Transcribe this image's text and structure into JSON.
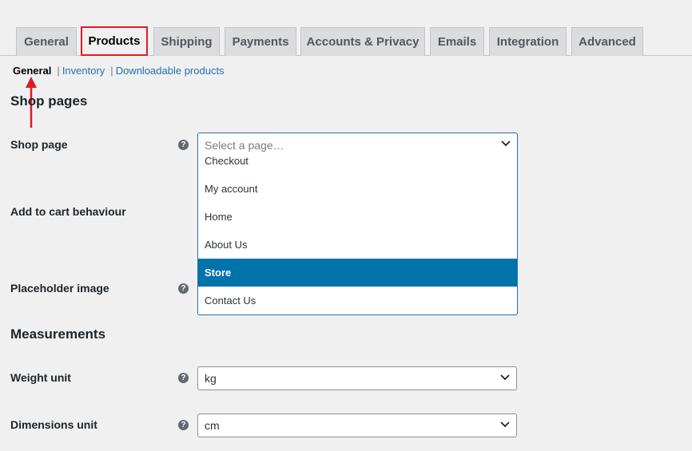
{
  "tabs": [
    {
      "label": "General"
    },
    {
      "label": "Products",
      "active": true
    },
    {
      "label": "Shipping"
    },
    {
      "label": "Payments"
    },
    {
      "label": "Accounts & Privacy"
    },
    {
      "label": "Emails"
    },
    {
      "label": "Integration"
    },
    {
      "label": "Advanced"
    }
  ],
  "subnav": {
    "current": "General",
    "links": [
      "Inventory",
      "Downloadable products"
    ]
  },
  "sections": {
    "shop_pages": "Shop pages",
    "measurements": "Measurements"
  },
  "fields": {
    "shop_page": {
      "label": "Shop page",
      "placeholder": "Select a page…",
      "options": [
        "Checkout",
        "My account",
        "Home",
        "About Us",
        "Store",
        "Contact Us"
      ],
      "highlighted": "Store"
    },
    "add_to_cart": {
      "label": "Add to cart behaviour"
    },
    "placeholder_image": {
      "label": "Placeholder image"
    },
    "weight_unit": {
      "label": "Weight unit",
      "value": "kg"
    },
    "dimensions_unit": {
      "label": "Dimensions unit",
      "value": "cm"
    }
  },
  "help_glyph": "?",
  "colors": {
    "accent": "#2271b1",
    "highlight": "#0073aa",
    "annotation": "#e01b24"
  },
  "icons": [
    "question-circle-icon",
    "chevron-down-icon",
    "arrow-up-icon"
  ]
}
